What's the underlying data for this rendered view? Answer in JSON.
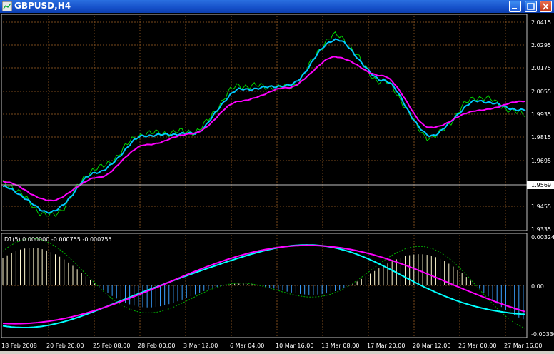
{
  "window": {
    "title": "GBPUSD,H4",
    "minimize_icon": "minimize-icon",
    "maximize_icon": "maximize-icon",
    "close_icon": "close-icon"
  },
  "colors": {
    "background": "#000000",
    "grid": "#7a4a1c",
    "axis": "#c0c0c0",
    "price_line": "#00d400",
    "fast_ma": "#00c8ff",
    "slow_ma": "#ff00ff",
    "osc_fast": "#00ffff",
    "osc_slow": "#ff00ff",
    "osc_signal": "#00b000",
    "hist_pos": "#fff8d0",
    "hist_neg": "#3aa0ff"
  },
  "main_panel": {
    "price_labels": [
      "2.0415",
      "2.0295",
      "2.0175",
      "2.0055",
      "1.9935",
      "1.9815",
      "1.9695",
      "1.9569",
      "1.9455",
      "1.9335"
    ],
    "current_price": "1.9569"
  },
  "indicator_panel": {
    "label": "D1(5) 0.000000 -0.000755 -0.000755",
    "value_labels": [
      "0.00324",
      "0.00",
      "-0.00330"
    ]
  },
  "time_axis": {
    "labels": [
      "18 Feb 2008",
      "20 Feb 20:00",
      "25 Feb 08:00",
      "28 Feb 00:00",
      "3 Mar 12:00",
      "6 Mar 04:00",
      "10 Mar 16:00",
      "13 Mar 08:00",
      "17 Mar 20:00",
      "20 Mar 12:00",
      "25 Mar 00:00",
      "27 Mar 16:00"
    ]
  },
  "chart_data": {
    "type": "line",
    "symbol": "GBPUSD",
    "timeframe": "H4",
    "ylim": [
      1.9335,
      2.0415
    ],
    "x": [
      "18 Feb 2008",
      "20 Feb 20:00",
      "25 Feb 08:00",
      "28 Feb 00:00",
      "3 Mar 12:00",
      "6 Mar 04:00",
      "10 Mar 16:00",
      "13 Mar 08:00",
      "17 Mar 20:00",
      "20 Mar 12:00",
      "25 Mar 00:00",
      "27 Mar 16:00"
    ],
    "series": [
      {
        "values": [
          1.957,
          1.94,
          1.965,
          1.983,
          1.984,
          2.008,
          2.007,
          2.034,
          2.01,
          1.981,
          2.002,
          1.993
        ]
      },
      {
        "values": [
          1.955,
          1.942,
          1.963,
          1.982,
          1.983,
          2.006,
          2.008,
          2.032,
          2.011,
          1.982,
          2.0,
          1.995
        ]
      },
      {
        "values": [
          1.958,
          1.948,
          1.96,
          1.977,
          1.983,
          2.0,
          2.007,
          2.023,
          2.013,
          1.986,
          1.995,
          2.0
        ]
      }
    ],
    "indicator": {
      "name": "D1(5)",
      "values": [
        0.0,
        -0.000755,
        -0.000755
      ],
      "ylim": [
        -0.0033,
        0.00324
      ]
    }
  }
}
